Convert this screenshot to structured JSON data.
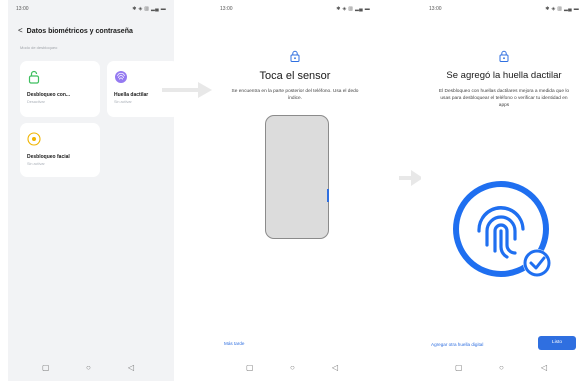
{
  "screen1": {
    "status": {
      "time": "13:00",
      "icons": "✱ ◈ ▥ ▂▄ ▬"
    },
    "back_title": "Datos biométricos y contraseña",
    "section_label": "Modo de desbloqueo",
    "cards": [
      {
        "title": "Desbloqueo con...",
        "subtitle": "Desactivar",
        "icon": "lock-icon",
        "color": "#3fbf5f"
      },
      {
        "title": "Huella dactilar",
        "subtitle": "Sin activar",
        "icon": "fingerprint-icon",
        "color": "#8a6cf0"
      },
      {
        "title": "Desbloqueo facial",
        "subtitle": "Sin activar",
        "icon": "face-icon",
        "color": "#f0b400"
      }
    ]
  },
  "screen2": {
    "status": {
      "time": "13:00",
      "icons": "✱ ◈ ▥ ▂▄ ▬"
    },
    "title": "Toca el sensor",
    "description": "Se encuentra en la parte posterior del teléfono. Usa el dedo índice.",
    "later_link": "Más tarde"
  },
  "screen3": {
    "status": {
      "time": "13:00",
      "icons": "✱ ◈ ▥ ▂▄ ▬"
    },
    "title": "Se agregó la huella dactilar",
    "description": "El Desbloqueo con huellas dactilares mejora a medida que lo usas para desbloquear el teléfono o verificar tu identidad en apps",
    "add_another_link": "Agregar otra huella digital",
    "done_button": "Listo"
  },
  "nav": {
    "square": "▢",
    "circle": "○",
    "triangle": "◁"
  },
  "colors": {
    "accent": "#2f6fe0",
    "fingerprint_blue": "#1f6ff0",
    "background_gray": "#f2f3f5"
  }
}
